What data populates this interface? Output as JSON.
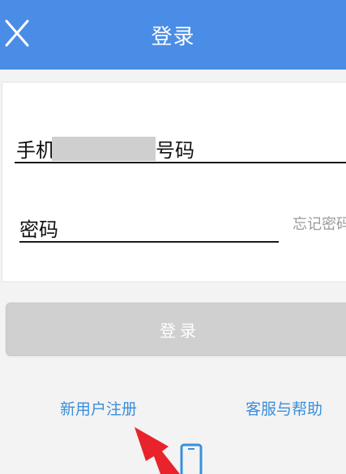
{
  "header": {
    "title": "登录",
    "background": "#4a8de6"
  },
  "form": {
    "phone_label_start": "手机",
    "phone_label_end": "号码",
    "password_label": "密码",
    "forgot_password": "忘记密码"
  },
  "login_button": {
    "label": "登录"
  },
  "links": {
    "register": "新用户注册",
    "help": "客服与帮助"
  },
  "colors": {
    "link": "#3a8fdc",
    "disabled_button": "#d0d0d0",
    "annotation_arrow": "#e8232b"
  },
  "icons": {
    "close": "close-icon",
    "bottom": "mobile-phone-icon"
  }
}
